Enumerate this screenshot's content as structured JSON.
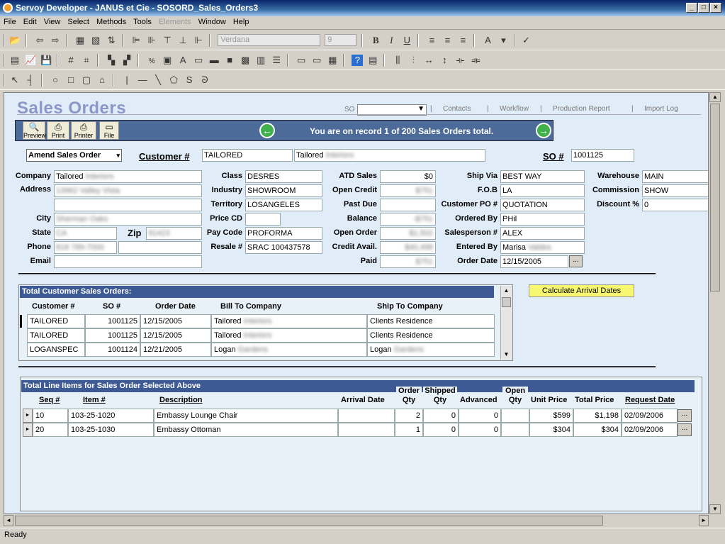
{
  "window": {
    "title": "Servoy Developer - JANUS et Cie - SOSORD_Sales_Orders3"
  },
  "menu": [
    "File",
    "Edit",
    "View",
    "Select",
    "Methods",
    "Tools",
    "Elements",
    "Window",
    "Help"
  ],
  "toolbar": {
    "font": "Verdana",
    "size": "9"
  },
  "form": {
    "title": "Sales Orders",
    "so_label": "SO",
    "links": [
      "Contacts",
      "Workflow",
      "Production Report",
      "Import Log"
    ],
    "nav": {
      "preview": "Preview",
      "print": "Print",
      "printer": "Printer",
      "file": "File",
      "message": "You are on record 1 of 200 Sales Orders total."
    },
    "mode": "Amend Sales Order",
    "customer_label": "Customer #",
    "customer_no": "TAILORED",
    "customer_name": "Tailored",
    "customer_name_extra": "Interiors",
    "so_no_label": "SO #",
    "so_no": "1001125",
    "address": {
      "company_label": "Company",
      "company": "Tailored",
      "company_extra": "Interiors",
      "address_label": "Address",
      "address": "13962 Valley Vista",
      "city_label": "City",
      "city": "Sherman Oaks",
      "state_label": "State",
      "state": "CA",
      "zip_label": "Zip",
      "zip": "91423",
      "phone_label": "Phone",
      "phone": "818 789-7000",
      "email_label": "Email"
    },
    "class": {
      "class_label": "Class",
      "class": "DESRES",
      "industry_label": "Industry",
      "industry": "SHOWROOM",
      "territory_label": "Territory",
      "territory": "LOSANGELES",
      "pricecd_label": "Price CD",
      "paycode_label": "Pay Code",
      "paycode": "PROFORMA",
      "resale_label": "Resale #",
      "resale": "SRAC 100437578"
    },
    "credit": {
      "atd_label": "ATD Sales",
      "atd": "$0",
      "open_credit_label": "Open Credit",
      "open_credit": "$751",
      "past_due_label": "Past Due",
      "balance_label": "Balance",
      "balance": "-$751",
      "open_order_label": "Open Order",
      "open_order": "$1,502",
      "credit_avail_label": "Credit Avail.",
      "credit_avail": "$40,498",
      "paid_label": "Paid",
      "paid": "$751"
    },
    "shipping": {
      "ship_via_label": "Ship Via",
      "ship_via": "BEST WAY",
      "fob_label": "F.O.B",
      "fob": "LA",
      "po_label": "Customer PO #",
      "po": "QUOTATION",
      "ordered_by_label": "Ordered By",
      "ordered_by": "PHil",
      "salesperson_label": "Salesperson #",
      "salesperson": "ALEX",
      "entered_by_label": "Entered By",
      "entered_by": "Marisa",
      "entered_by_extra": "Valdes",
      "order_date_label": "Order Date",
      "order_date": "12/15/2005",
      "ellipsis": "..."
    },
    "warehouse": {
      "warehouse_label": "Warehouse",
      "warehouse": "MAIN",
      "commission_label": "Commission",
      "commission": "SHOW",
      "discount_label": "Discount %",
      "discount": "0"
    },
    "orders": {
      "title": "Total Customer Sales Orders:",
      "headers": [
        "Customer #",
        "SO #",
        "Order Date",
        "Bill To Company",
        "Ship To Company"
      ],
      "rows": [
        {
          "cust": "TAILORED",
          "so": "1001125",
          "date": "12/15/2005",
          "bill": "Tailored",
          "bill_extra": "Interiors",
          "ship": "Clients Residence",
          "ship_extra": ""
        },
        {
          "cust": "TAILORED",
          "so": "1001125",
          "date": "12/15/2005",
          "bill": "Tailored",
          "bill_extra": "Interiors",
          "ship": "Clients Residence",
          "ship_extra": ""
        },
        {
          "cust": "LOGANSPEC",
          "so": "1001124",
          "date": "12/21/2005",
          "bill": "Logan",
          "bill_extra": "Gardens",
          "ship": "Logan",
          "ship_extra": "Gardens"
        }
      ]
    },
    "calc_button": "Calculate Arrival Dates",
    "lines": {
      "title": "Total Line Items for Sales Order Selected Above",
      "headers": {
        "seq": "Seq #",
        "item": "Item #",
        "desc": "Description",
        "arrival": "Arrival Date",
        "order1": "Order",
        "order2": "Qty",
        "shipped1": "Shipped",
        "shipped2": "Qty",
        "advanced": "Advanced",
        "open1": "Open",
        "open2": "Qty",
        "unit": "Unit Price",
        "total": "Total Price",
        "req": "Request Date"
      },
      "rows": [
        {
          "seq": "10",
          "item": "103-25-1020",
          "desc": "Embassy Lounge Chair",
          "arrival": "",
          "order": "2",
          "shipped": "0",
          "advanced": "0",
          "open": "",
          "unit": "$599",
          "total": "$1,198",
          "req": "02/09/2006"
        },
        {
          "seq": "20",
          "item": "103-25-1030",
          "desc": "Embassy Ottoman",
          "arrival": "",
          "order": "1",
          "shipped": "0",
          "advanced": "0",
          "open": "",
          "unit": "$304",
          "total": "$304",
          "req": "02/09/2006"
        }
      ]
    }
  },
  "status": "Ready"
}
